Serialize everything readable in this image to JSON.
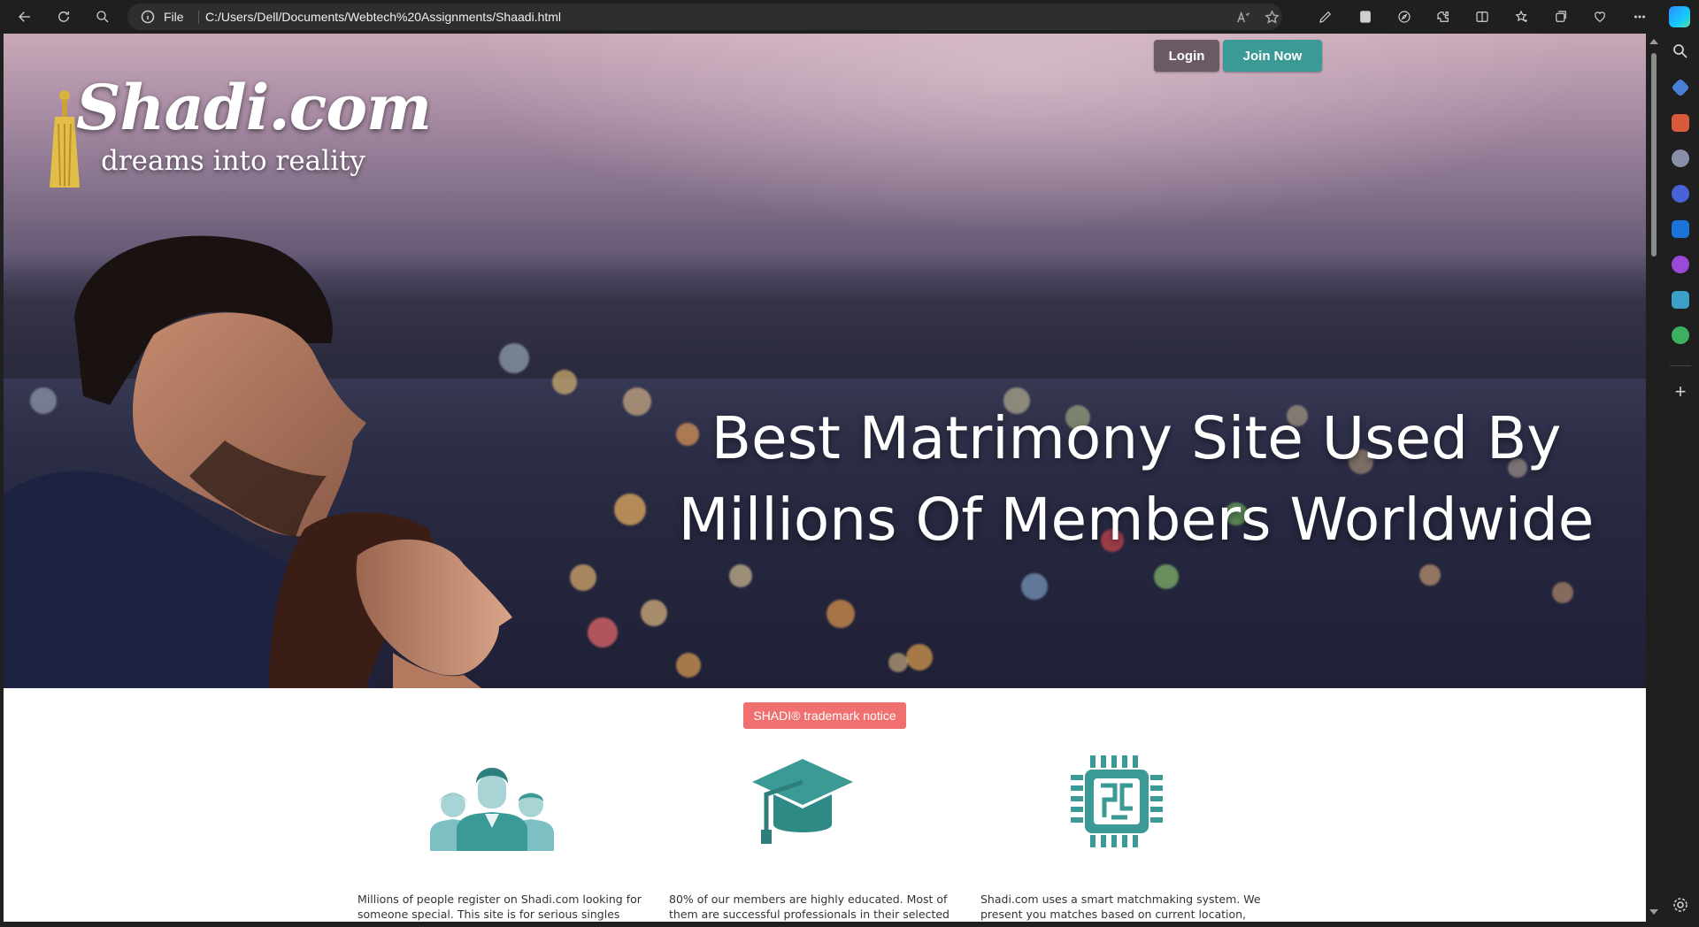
{
  "browser": {
    "address_prefix": "File",
    "url": "C:/Users/Dell/Documents/Webtech%20Assignments/Shaadi.html",
    "icons": {
      "back": "back-arrow-icon",
      "refresh": "refresh-icon",
      "search": "search-icon",
      "info": "info-icon",
      "read_aloud": "read-aloud-icon",
      "favorite": "star-icon"
    }
  },
  "site": {
    "logo_main": "Shadi.com",
    "logo_sub": "dreams into reality",
    "login_label": "Login",
    "join_label": "Join Now",
    "headline_line1": "Best Matrimony Site Used By",
    "headline_line2": "Millions Of Members Worldwide",
    "trademark_label": "SHADI® trademark notice",
    "features": [
      {
        "icon": "people-group-icon",
        "text": "Millions of people register on Shadi.com looking for someone special. This site is for serious singles looking for a long lasting"
      },
      {
        "icon": "graduation-cap-icon",
        "text": "80% of our members are highly educated. Most of them are successful professionals in their selected fields."
      },
      {
        "icon": "processor-chip-icon",
        "text": "Shadi.com uses a smart matchmaking system. We present you matches based on current location, education level & lifestyle"
      }
    ]
  },
  "colors": {
    "login_bg": "#6b5a63",
    "join_bg": "#3b9a96",
    "notice_bg": "#f07070",
    "icon_teal": "#3b9a96"
  }
}
